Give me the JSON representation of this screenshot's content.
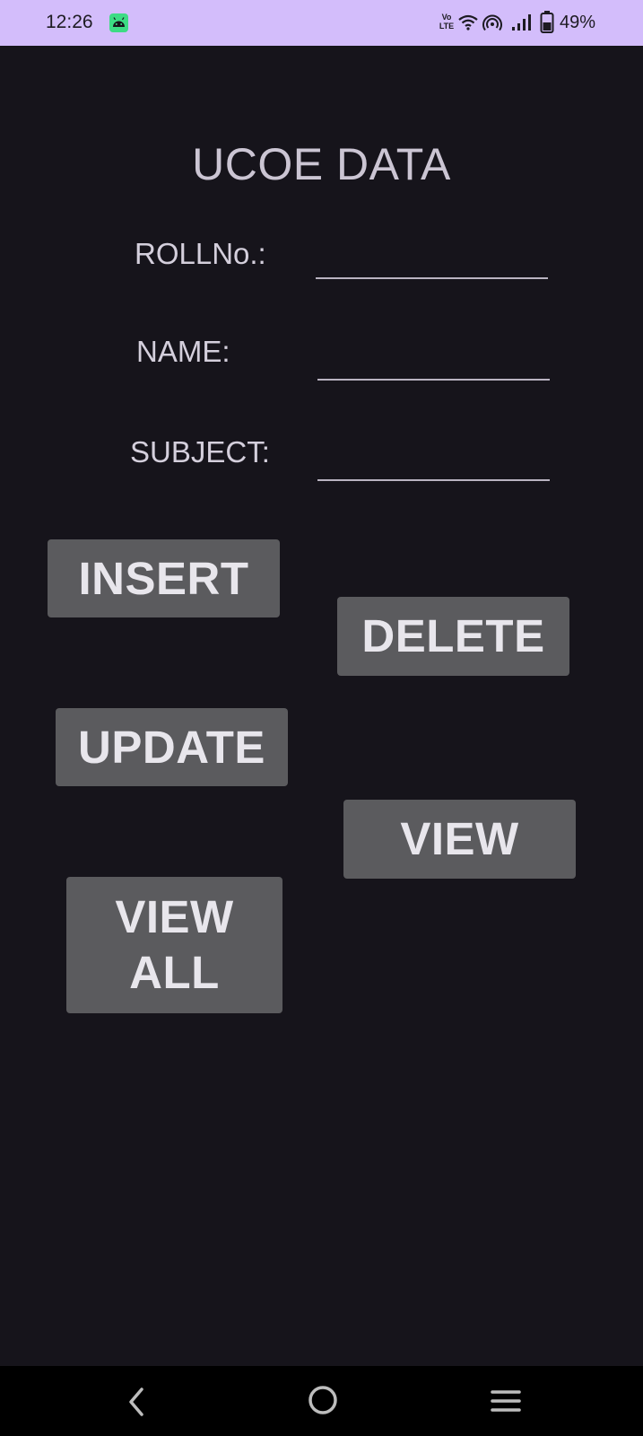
{
  "status_bar": {
    "time": "12:26",
    "volte_label": "Vo LTE",
    "battery_percent": "49%",
    "icons": [
      "android-icon",
      "volte-icon",
      "wifi-icon",
      "hotspot-icon",
      "signal-icon",
      "battery-icon"
    ]
  },
  "page": {
    "title": "UCOE DATA"
  },
  "form": {
    "roll_label": "ROLLNo.:",
    "roll_value": "",
    "name_label": "NAME:",
    "name_value": "",
    "subject_label": "SUBJECT:",
    "subject_value": ""
  },
  "buttons": {
    "insert": "INSERT",
    "delete": "DELETE",
    "update": "UPDATE",
    "view": "VIEW",
    "view_all_line1": "VIEW",
    "view_all_line2": "ALL"
  },
  "nav_bar": {
    "icons": [
      "back-icon",
      "home-icon",
      "recents-icon"
    ]
  },
  "colors": {
    "status_bar_bg": "#d3bdfb",
    "screen_bg": "#16141b",
    "button_bg": "#5b5b5e",
    "button_text": "#e8e6ec"
  }
}
